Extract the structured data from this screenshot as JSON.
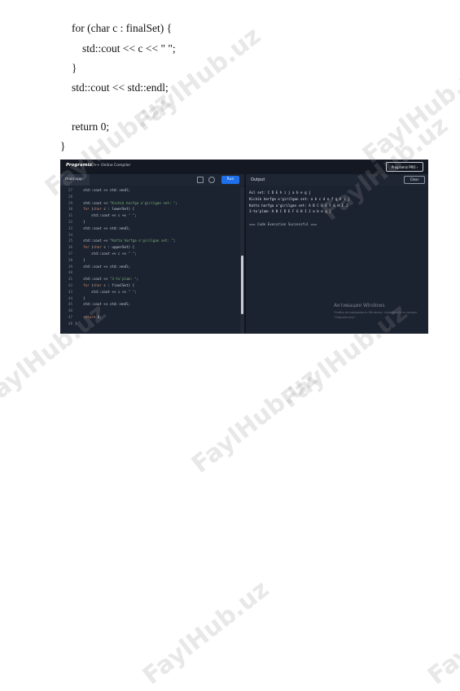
{
  "document": {
    "lines": [
      "for (char c : finalSet) {",
      "std::cout << c << \" \";",
      "}",
      "std::cout << std::endl;",
      "return 0;",
      "}"
    ]
  },
  "watermark": {
    "text": "FaylHub.uz"
  },
  "screenshot": {
    "brand": "Programiz",
    "brand_sub": "C++ Online Compiler",
    "pro_button": "Programiz PRO ›",
    "file_tab": "main.cpp",
    "run_button": "Run",
    "output_title": "Output",
    "clear_button": "Clear",
    "code_lines": [
      {
        "n": "27",
        "code": "    std::cout << std::endl;"
      },
      {
        "n": "28",
        "code": ""
      },
      {
        "n": "29",
        "code": "    std::cout << \"Kichik harfga o'girilgan set: \";"
      },
      {
        "n": "30",
        "code": "    for (char c : lowerSet) {"
      },
      {
        "n": "31",
        "code": "        std::cout << c << \" \";"
      },
      {
        "n": "32",
        "code": "    }"
      },
      {
        "n": "33",
        "code": "    std::cout << std::endl;"
      },
      {
        "n": "34",
        "code": ""
      },
      {
        "n": "35",
        "code": "    std::cout << \"Katta harfga o'girilgan set: \";"
      },
      {
        "n": "36",
        "code": "    for (char c : upperSet) {"
      },
      {
        "n": "37",
        "code": "        std::cout << c << \" \";"
      },
      {
        "n": "38",
        "code": "    }"
      },
      {
        "n": "39",
        "code": "    std::cout << std::endl;"
      },
      {
        "n": "40",
        "code": ""
      },
      {
        "n": "41",
        "code": "    std::cout << \"3-to'plam: \";"
      },
      {
        "n": "42",
        "code": "    for (char c : finalSet) {"
      },
      {
        "n": "43",
        "code": "        std::cout << c << \" \";"
      },
      {
        "n": "44",
        "code": "    }"
      },
      {
        "n": "45",
        "code": "    std::cout << std::endl;"
      },
      {
        "n": "46",
        "code": ""
      },
      {
        "n": "47",
        "code": "    return 0;"
      },
      {
        "n": "48",
        "code": "}"
      }
    ],
    "output_lines": [
      "Asl set: C D E h i j a b e g j",
      "Kichik harfga o'girilgan set: a b c d e f g h i j",
      "Katta harfga o'girilgan set: A B C D E F G H I J",
      "3-to'plam: A B C D E F G H I J a b e g j",
      "",
      "=== Code Execution Successful ==="
    ],
    "activation_title": "Активация Windows",
    "activation_sub": "Чтобы активировать Windows, перейдите в раздел \"Параметры\"."
  },
  "colors": {
    "editor_bg": "#1b2230",
    "run_button": "#1f6feb",
    "keyword": "#cf8e6d",
    "string": "#7fb37a"
  }
}
